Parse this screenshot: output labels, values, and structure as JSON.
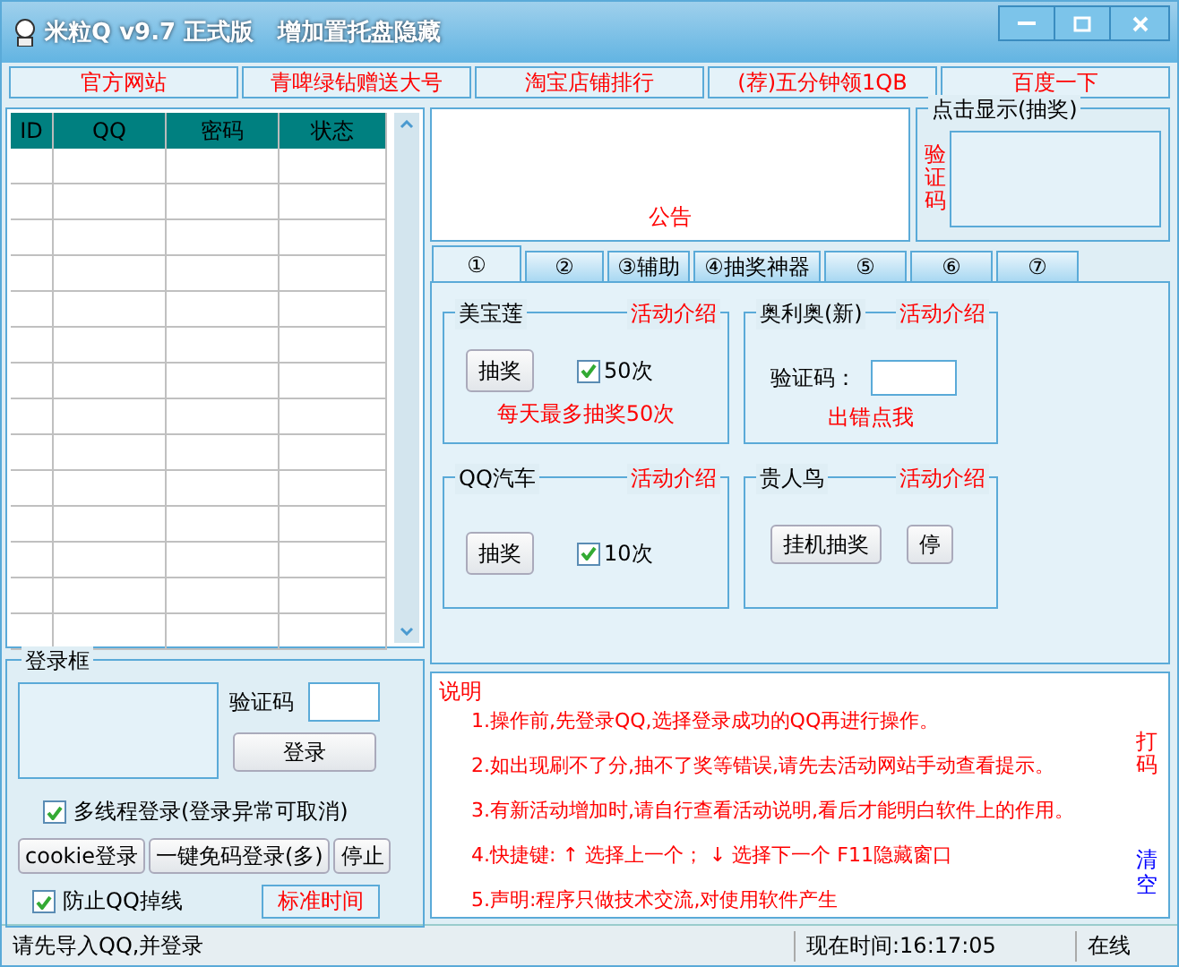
{
  "window": {
    "title": "米粒Q v9.7 正式版   增加置托盘隐藏"
  },
  "links": [
    "官方网站",
    "青啤绿钻赠送大号",
    "淘宝店铺排行",
    "(荐)五分钟领1QB",
    "百度一下"
  ],
  "account_table": {
    "columns": [
      "ID",
      "QQ",
      "密码",
      "状态"
    ]
  },
  "notice": {
    "title": "公告"
  },
  "captcha_panel": {
    "title": "点击显示(抽奖)",
    "label": "验证码"
  },
  "tabs": [
    {
      "label": "①",
      "selected": true
    },
    {
      "label": "②",
      "selected": false
    },
    {
      "label": "③辅助",
      "selected": false
    },
    {
      "label": "④抽奖神器",
      "selected": false
    },
    {
      "label": "⑤",
      "selected": false
    },
    {
      "label": "⑥",
      "selected": false
    },
    {
      "label": "⑦",
      "selected": false
    }
  ],
  "activities": [
    {
      "kind": "draw",
      "title": "美宝莲",
      "intro": "活动介绍",
      "button": "抽奖",
      "check": {
        "label": "50次",
        "checked": true
      },
      "note": "每天最多抽奖50次"
    },
    {
      "kind": "captcha",
      "title": "奥利奥(新)",
      "intro": "活动介绍",
      "label": "验证码：",
      "note": "出错点我"
    },
    {
      "kind": "draw",
      "title": "QQ汽车",
      "intro": "活动介绍",
      "button": "抽奖",
      "check": {
        "label": "10次",
        "checked": true
      }
    },
    {
      "kind": "auto",
      "title": "贵人鸟",
      "intro": "活动介绍",
      "buttons": [
        "挂机抽奖",
        "停"
      ]
    }
  ],
  "login": {
    "title": "登录框",
    "captcha_label": "验证码",
    "login_button": "登录",
    "multi_thread": {
      "label": "多线程登录(登录异常可取消)",
      "checked": true
    },
    "buttons": [
      "cookie登录",
      "一键免码登录(多)",
      "停止"
    ],
    "keep_online": {
      "label": "防止QQ掉线",
      "checked": true
    },
    "time_button": "标准时间"
  },
  "help": {
    "title": "说明",
    "lines": [
      "1.操作前,先登录QQ,选择登录成功的QQ再进行操作。",
      "2.如出现刷不了分,抽不了奖等错误,请先去活动网站手动查看提示。",
      "3.有新活动增加时,请自行查看活动说明,看后才能明白软件上的作用。",
      "4.快捷键: ↑ 选择上一个； ↓ 选择下一个    F11隐藏窗口",
      "5.声明:程序只做技术交流,对使用软件产生"
    ],
    "side_links": [
      "打码",
      "清空"
    ]
  },
  "status_bar": [
    "请先导入QQ,并登录",
    "现在时间:16:17:05",
    "在线"
  ]
}
